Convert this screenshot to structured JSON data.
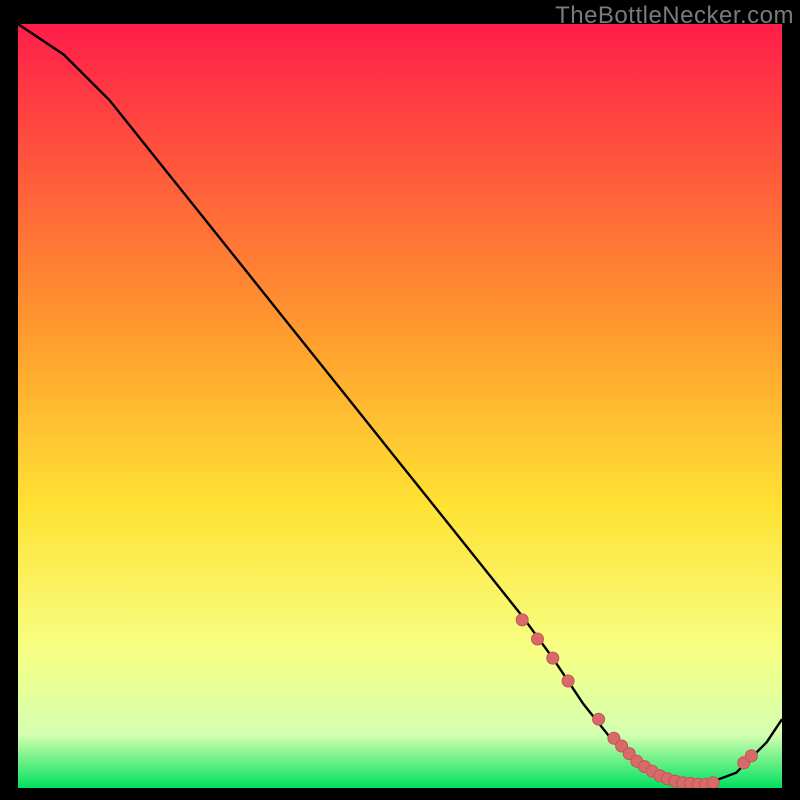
{
  "watermark": "TheBottleNecker.com",
  "colors": {
    "bg_black": "#000000",
    "grad_top": "#ff1d49",
    "grad_mid1": "#ff7e2e",
    "grad_mid2": "#ffe233",
    "grad_mid3": "#f7ff84",
    "grad_mid4": "#d4ffb0",
    "grad_bottom": "#00e060",
    "curve": "#000000",
    "marker_fill": "#d86a6a",
    "marker_stroke": "#c25454"
  },
  "chart_data": {
    "type": "line",
    "title": "",
    "xlabel": "",
    "ylabel": "",
    "xlim": [
      0,
      100
    ],
    "ylim": [
      0,
      100
    ],
    "curve": {
      "x": [
        0,
        6,
        12,
        18,
        24,
        30,
        36,
        42,
        48,
        54,
        60,
        66,
        70,
        74,
        78,
        82,
        86,
        90,
        94,
        98,
        100
      ],
      "y": [
        100,
        96,
        90,
        82.5,
        75,
        67.5,
        60,
        52.5,
        45,
        37.5,
        30,
        22.5,
        17,
        11,
        6,
        2.5,
        0.8,
        0.5,
        2,
        6,
        9
      ]
    },
    "markers": {
      "x": [
        66,
        68,
        70,
        72,
        76,
        78,
        79,
        80,
        81,
        82,
        83,
        84,
        85,
        86,
        87,
        88,
        89,
        90,
        91,
        95,
        96
      ],
      "y": [
        22,
        19.5,
        17,
        14,
        9,
        6.5,
        5.5,
        4.5,
        3.5,
        2.8,
        2.2,
        1.6,
        1.2,
        0.9,
        0.7,
        0.6,
        0.5,
        0.5,
        0.7,
        3.3,
        4.2
      ]
    }
  }
}
